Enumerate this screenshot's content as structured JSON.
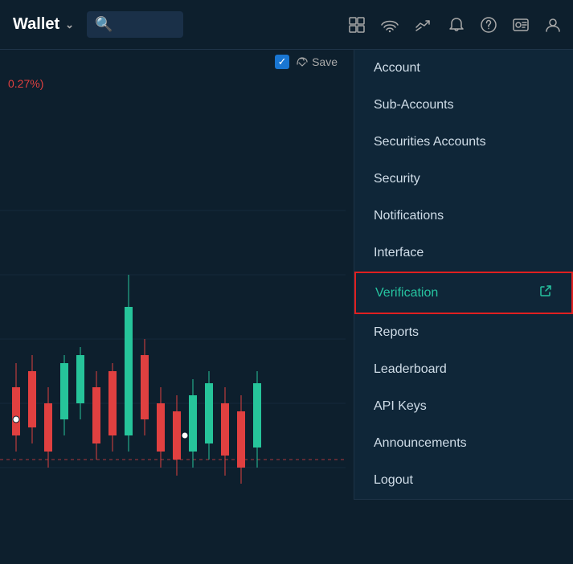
{
  "navbar": {
    "wallet_label": "Wallet",
    "chevron": "∨",
    "search_placeholder": ""
  },
  "nav_icons": [
    {
      "name": "grid-icon",
      "symbol": "⊞"
    },
    {
      "name": "signal-icon",
      "symbol": "((·))"
    },
    {
      "name": "handshake-icon",
      "symbol": "🤝"
    },
    {
      "name": "bell-icon",
      "symbol": "🔔"
    },
    {
      "name": "question-icon",
      "symbol": "?"
    },
    {
      "name": "portrait-icon",
      "symbol": "🪪"
    },
    {
      "name": "user-icon",
      "symbol": "👤"
    }
  ],
  "chart": {
    "price_label": "0.27%)",
    "save_label": "Save",
    "checkbox_checked": true
  },
  "dropdown": {
    "items": [
      {
        "id": "account",
        "label": "Account",
        "highlighted": false,
        "external": false
      },
      {
        "id": "sub-accounts",
        "label": "Sub-Accounts",
        "highlighted": false,
        "external": false
      },
      {
        "id": "securities-accounts",
        "label": "Securities Accounts",
        "highlighted": false,
        "external": false
      },
      {
        "id": "security",
        "label": "Security",
        "highlighted": false,
        "external": false
      },
      {
        "id": "notifications",
        "label": "Notifications",
        "highlighted": false,
        "external": false
      },
      {
        "id": "interface",
        "label": "Interface",
        "highlighted": false,
        "external": false
      },
      {
        "id": "verification",
        "label": "Verification",
        "highlighted": true,
        "external": true
      },
      {
        "id": "reports",
        "label": "Reports",
        "highlighted": false,
        "external": false
      },
      {
        "id": "leaderboard",
        "label": "Leaderboard",
        "highlighted": false,
        "external": false
      },
      {
        "id": "api-keys",
        "label": "API Keys",
        "highlighted": false,
        "external": false
      },
      {
        "id": "announcements",
        "label": "Announcements",
        "highlighted": false,
        "external": false
      },
      {
        "id": "logout",
        "label": "Logout",
        "highlighted": false,
        "external": false
      }
    ]
  }
}
